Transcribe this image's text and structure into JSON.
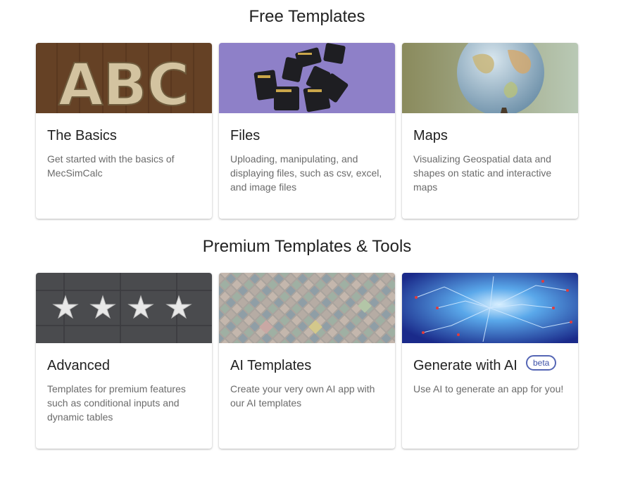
{
  "free": {
    "title": "Free Templates",
    "cards": [
      {
        "title": "The Basics",
        "desc": "Get started with the basics of MecSimCalc",
        "image": "wood-abc-letters-image"
      },
      {
        "title": "Files",
        "desc": "Uploading, manipulating, and displaying files, such as csv, excel, and image files",
        "image": "sd-cards-image"
      },
      {
        "title": "Maps",
        "desc": "Visualizing Geospatial data and shapes on static and interactive maps",
        "image": "globe-image"
      }
    ]
  },
  "premium": {
    "title": "Premium Templates & Tools",
    "cards": [
      {
        "title": "Advanced",
        "desc": "Templates for premium features such as conditional inputs and dynamic tables",
        "image": "stars-on-stone-image"
      },
      {
        "title": "AI Templates",
        "desc": "Create your very own AI app with our AI templates",
        "image": "tile-pattern-image"
      },
      {
        "title": "Generate with AI",
        "desc": "Use AI to generate an app for you!",
        "badge": "beta",
        "image": "neural-circuit-image"
      }
    ]
  },
  "colors": {
    "badge_border": "#5566b5",
    "text_secondary": "#6b6b6b"
  }
}
